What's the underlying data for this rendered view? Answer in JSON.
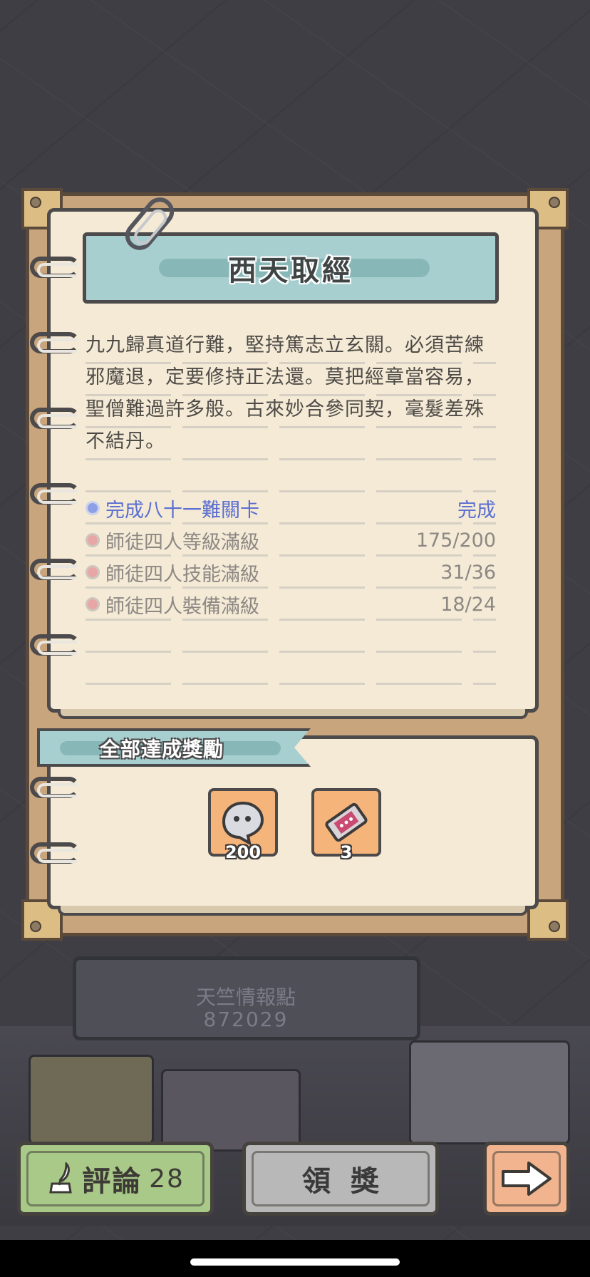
{
  "title": "西天取經",
  "poem": "九九歸真道行難，堅持篤志立玄關。必須苦練邪魔退，定要修持正法還。莫把經章當容易，聖僧難過許多般。古來妙合參同契，毫髮差殊不結丹。",
  "tasks": [
    {
      "label": "完成八十一難關卡",
      "status": "完成",
      "done": true
    },
    {
      "label": "師徒四人等級滿級",
      "status": "175/200",
      "done": false
    },
    {
      "label": "師徒四人技能滿級",
      "status": "31/36",
      "done": false
    },
    {
      "label": "師徒四人裝備滿級",
      "status": "18/24",
      "done": false
    }
  ],
  "reward_section": {
    "title": "全部達成獎勵",
    "items": [
      {
        "icon": "ghost-token-icon",
        "count": "200"
      },
      {
        "icon": "ticket-icon",
        "count": "3"
      }
    ]
  },
  "plaque": {
    "label": "天竺情報點",
    "value": "872029"
  },
  "buttons": {
    "comment_label": "評論",
    "comment_count": "28",
    "claim_label": "領獎",
    "next_icon": "arrow-right-icon"
  },
  "colors": {
    "done_task": "#5b6fd0",
    "pending_task": "#8d8884",
    "banner": "#a8cfd0",
    "comment_button": "#a8c988",
    "next_button": "#f2b48e"
  }
}
